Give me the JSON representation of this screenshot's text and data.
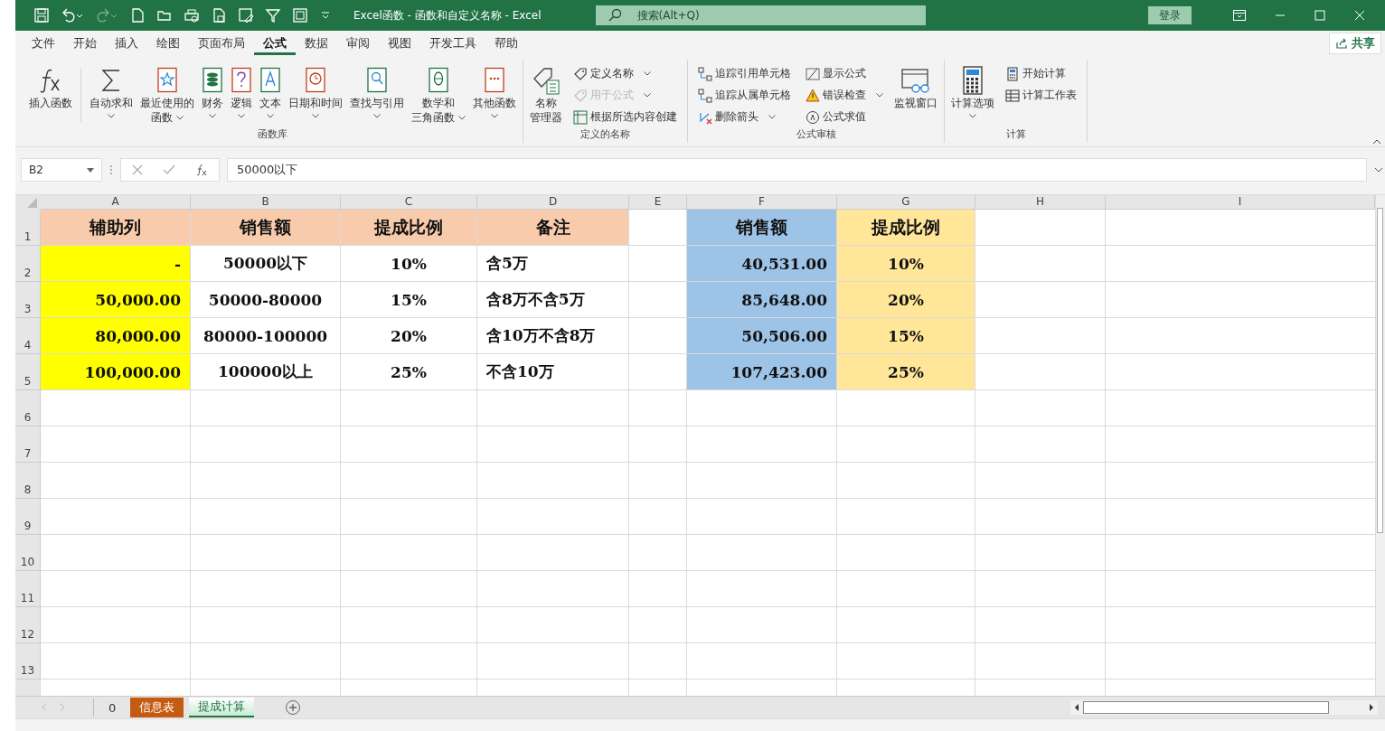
{
  "window": {
    "title": "Excel函数 - 函数和自定义名称  -  Excel",
    "search_placeholder": "搜索(Alt+Q)",
    "login": "登录"
  },
  "menu_tabs": [
    {
      "label": "文件",
      "selected": false
    },
    {
      "label": "开始",
      "selected": false
    },
    {
      "label": "插入",
      "selected": false
    },
    {
      "label": "绘图",
      "selected": false
    },
    {
      "label": "页面布局",
      "selected": false
    },
    {
      "label": "公式",
      "selected": true
    },
    {
      "label": "数据",
      "selected": false
    },
    {
      "label": "审阅",
      "selected": false
    },
    {
      "label": "视图",
      "selected": false
    },
    {
      "label": "开发工具",
      "selected": false
    },
    {
      "label": "帮助",
      "selected": false
    }
  ],
  "share": "共享",
  "ribbon_groups": [
    {
      "label": "函数库",
      "items": [
        {
          "kind": "large",
          "lines": [
            "插入函数"
          ],
          "dropdown": false
        },
        {
          "kind": "large",
          "lines": [
            "自动求和"
          ],
          "dropdown": true
        },
        {
          "kind": "large",
          "lines": [
            "最近使用的",
            "函数"
          ],
          "dropdown": true
        },
        {
          "kind": "large",
          "lines": [
            "财务"
          ],
          "dropdown": true
        },
        {
          "kind": "large",
          "lines": [
            "逻辑"
          ],
          "dropdown": true
        },
        {
          "kind": "large",
          "lines": [
            "文本"
          ],
          "dropdown": true
        },
        {
          "kind": "large",
          "lines": [
            "日期和时间"
          ],
          "dropdown": true
        },
        {
          "kind": "large",
          "lines": [
            "查找与引用"
          ],
          "dropdown": true
        },
        {
          "kind": "large",
          "lines": [
            "数学和",
            "三角函数"
          ],
          "dropdown": true
        },
        {
          "kind": "large",
          "lines": [
            "其他函数"
          ],
          "dropdown": true
        }
      ]
    },
    {
      "label": "定义的名称",
      "items": [
        {
          "kind": "large",
          "lines": [
            "名称",
            "管理器"
          ],
          "dropdown": false
        },
        {
          "kind": "stack",
          "buttons": [
            {
              "label": "定义名称",
              "dropdown": true,
              "disabled": false
            },
            {
              "label": "用于公式",
              "dropdown": true,
              "disabled": true
            },
            {
              "label": "根据所选内容创建",
              "dropdown": false,
              "disabled": false
            }
          ]
        }
      ]
    },
    {
      "label": "公式审核",
      "items": [
        {
          "kind": "stack",
          "buttons": [
            {
              "label": "追踪引用单元格",
              "dropdown": false,
              "disabled": false
            },
            {
              "label": "追踪从属单元格",
              "dropdown": false,
              "disabled": false
            },
            {
              "label": "删除箭头",
              "dropdown": true,
              "disabled": false
            }
          ]
        },
        {
          "kind": "stack",
          "buttons": [
            {
              "label": "显示公式",
              "dropdown": false,
              "disabled": false
            },
            {
              "label": "错误检查",
              "dropdown": true,
              "disabled": false
            },
            {
              "label": "公式求值",
              "dropdown": false,
              "disabled": false
            }
          ]
        },
        {
          "kind": "large",
          "lines": [
            "监视窗口"
          ],
          "dropdown": false
        }
      ]
    },
    {
      "label": "计算",
      "items": [
        {
          "kind": "large",
          "lines": [
            "计算选项"
          ],
          "dropdown": true
        },
        {
          "kind": "stack",
          "buttons": [
            {
              "label": "开始计算",
              "dropdown": false,
              "disabled": false
            },
            {
              "label": "计算工作表",
              "dropdown": false,
              "disabled": false
            }
          ]
        }
      ]
    }
  ],
  "formula_bar": {
    "name_box": "B2",
    "value": "50000以下"
  },
  "columns": [
    "A",
    "B",
    "C",
    "D",
    "E",
    "F",
    "G",
    "H",
    "I"
  ],
  "rows": [
    {
      "header": "1",
      "cells": [
        {
          "text": "辅助列",
          "color": "#f8cbad"
        },
        {
          "text": "销售额",
          "color": "#f8cbad"
        },
        {
          "text": "提成比例",
          "color": "#f8cbad"
        },
        {
          "text": "备注",
          "color": "#f8cbad"
        },
        {
          "text": ""
        },
        {
          "text": "销售额",
          "color": "#9dc3e6"
        },
        {
          "text": "提成比例",
          "color": "#ffe699"
        },
        {
          "text": ""
        },
        {
          "text": ""
        }
      ]
    },
    {
      "header": "2",
      "cells": [
        {
          "text": "-",
          "color": "#ffff00"
        },
        {
          "text": "50000以下"
        },
        {
          "text": "10%"
        },
        {
          "text": "含5万"
        },
        {
          "text": ""
        },
        {
          "text": "40,531.00",
          "color": "#9dc3e6"
        },
        {
          "text": "10%",
          "color": "#ffe699"
        },
        {
          "text": ""
        },
        {
          "text": ""
        }
      ]
    },
    {
      "header": "3",
      "cells": [
        {
          "text": "50,000.00",
          "color": "#ffff00"
        },
        {
          "text": "50000-80000"
        },
        {
          "text": "15%"
        },
        {
          "text": "含8万不含5万"
        },
        {
          "text": ""
        },
        {
          "text": "85,648.00",
          "color": "#9dc3e6"
        },
        {
          "text": "20%",
          "color": "#ffe699"
        },
        {
          "text": ""
        },
        {
          "text": ""
        }
      ]
    },
    {
      "header": "4",
      "cells": [
        {
          "text": "80,000.00",
          "color": "#ffff00"
        },
        {
          "text": "80000-100000"
        },
        {
          "text": "20%"
        },
        {
          "text": "含10万不含8万"
        },
        {
          "text": ""
        },
        {
          "text": "50,506.00",
          "color": "#9dc3e6"
        },
        {
          "text": "15%",
          "color": "#ffe699"
        },
        {
          "text": ""
        },
        {
          "text": ""
        }
      ]
    },
    {
      "header": "5",
      "cells": [
        {
          "text": "100,000.00",
          "color": "#ffff00"
        },
        {
          "text": "100000以上"
        },
        {
          "text": "25%"
        },
        {
          "text": "不含10万"
        },
        {
          "text": ""
        },
        {
          "text": "107,423.00",
          "color": "#9dc3e6"
        },
        {
          "text": "25%",
          "color": "#ffe699"
        },
        {
          "text": ""
        },
        {
          "text": ""
        }
      ]
    },
    {
      "header": "6",
      "cells": []
    },
    {
      "header": "7",
      "cells": []
    },
    {
      "header": "8",
      "cells": []
    },
    {
      "header": "9",
      "cells": []
    },
    {
      "header": "10",
      "cells": []
    },
    {
      "header": "11",
      "cells": []
    },
    {
      "header": "12",
      "cells": []
    },
    {
      "header": "13",
      "cells": []
    }
  ],
  "sheet_tabs": [
    {
      "label": "0",
      "selected": false
    },
    {
      "label": "信息表",
      "selected": false,
      "color": "#c55a11"
    },
    {
      "label": "提成计算",
      "selected": true
    }
  ]
}
